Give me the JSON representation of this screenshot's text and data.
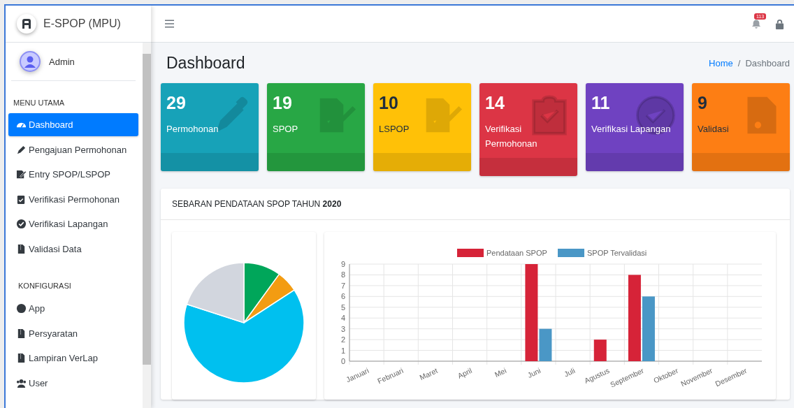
{
  "brand": {
    "title": "E-SPOP (MPU)"
  },
  "user": {
    "name": "Admin"
  },
  "sidebar": {
    "sections": [
      {
        "heading": "MENU UTAMA",
        "items": [
          {
            "label": "Dashboard",
            "selected": true
          },
          {
            "label": "Pengajuan Permohonan",
            "selected": false
          },
          {
            "label": "Entry SPOP/LSPOP",
            "selected": false
          },
          {
            "label": "Verifikasi Permohonan",
            "selected": false
          },
          {
            "label": "Verifikasi Lapangan",
            "selected": false
          },
          {
            "label": "Validasi Data",
            "selected": false
          }
        ]
      },
      {
        "heading": "KONFIGURASI",
        "items": [
          {
            "label": "App",
            "selected": false
          },
          {
            "label": "Persyaratan",
            "selected": false
          },
          {
            "label": "Lampiran VerLap",
            "selected": false
          },
          {
            "label": "User",
            "selected": false
          }
        ]
      }
    ]
  },
  "topbar": {
    "notification_count": "113"
  },
  "page": {
    "title": "Dashboard",
    "breadcrumb": [
      "Home",
      "Dashboard"
    ],
    "breadcrumb_separator": "/"
  },
  "cards": [
    {
      "count": "29",
      "label": "Permohonan",
      "color": "#17a2b8"
    },
    {
      "count": "19",
      "label": "SPOP",
      "color": "#28a745"
    },
    {
      "count": "10",
      "label": "LSPOP",
      "color": "#ffc107"
    },
    {
      "count": "14",
      "label": "Verifikasi Permohonan",
      "color": "#dc3545"
    },
    {
      "count": "11",
      "label": "Verifikasi Lapangan",
      "color": "#6f42c1"
    },
    {
      "count": "9",
      "label": "Validasi",
      "color": "#fd7e14"
    }
  ],
  "chart_panel": {
    "title": "SEBARAN PENDATAAN SPOP TAHUN **2020**",
    "chart_data": {
      "type": "bar",
      "categories": [
        "Januari",
        "Februari",
        "Maret",
        "April",
        "Mei",
        "Juni",
        "Juli",
        "Agustus",
        "September",
        "Oktober",
        "November",
        "Desember"
      ],
      "series": [
        {
          "name": "Pendataan SPOP",
          "color": "#d62338",
          "values": [
            0,
            0,
            0,
            0,
            0,
            9,
            0,
            2,
            8,
            0,
            0,
            0
          ]
        },
        {
          "name": "SPOP Tervalidasi",
          "color": "#4a97c6",
          "values": [
            0,
            0,
            0,
            0,
            0,
            3,
            0,
            0,
            6,
            0,
            0,
            0
          ]
        }
      ],
      "ylim": [
        0,
        9
      ],
      "yticks": [
        0,
        1,
        2,
        3,
        4,
        5,
        6,
        7,
        8,
        9
      ],
      "grid": true,
      "legend": true
    }
  }
}
